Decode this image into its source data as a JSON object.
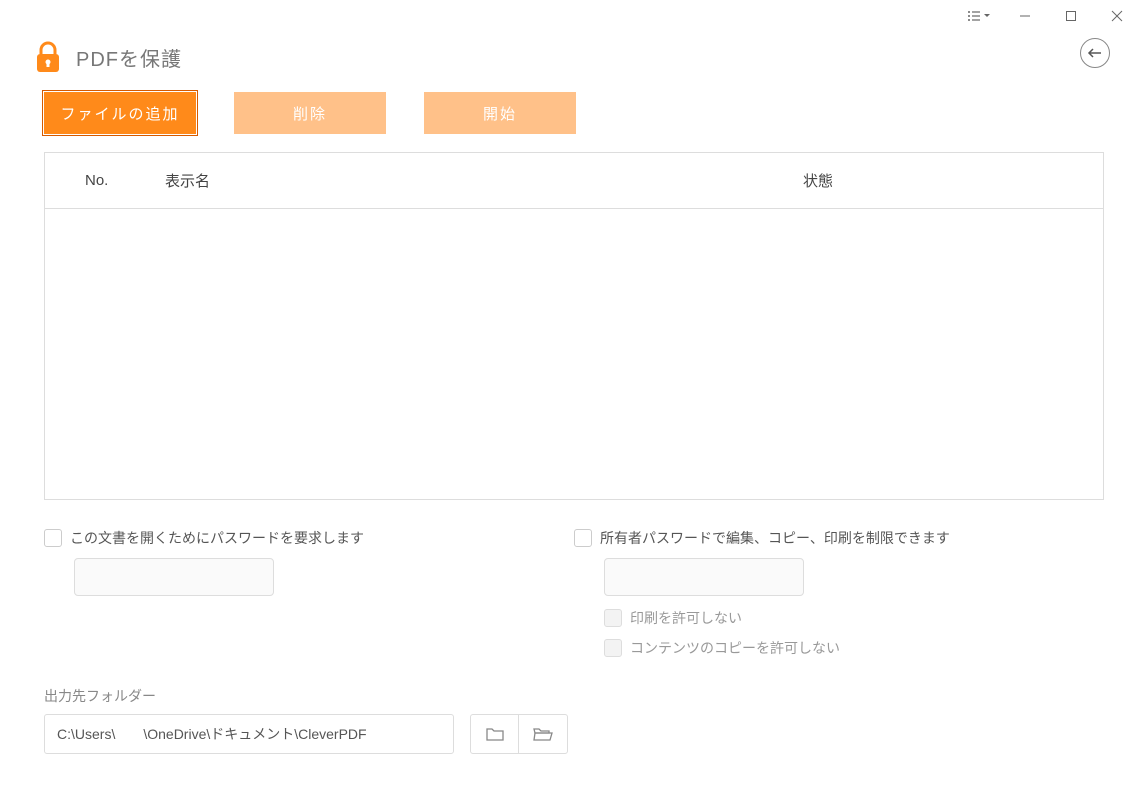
{
  "header": {
    "title": "PDFを保護"
  },
  "toolbar": {
    "add_file": "ファイルの追加",
    "delete": "削除",
    "start": "開始"
  },
  "table": {
    "columns": {
      "no": "No.",
      "name": "表示名",
      "status": "状態"
    }
  },
  "options": {
    "open_password_label": "この文書を開くためにパスワードを要求します",
    "owner_password_label": "所有者パスワードで編集、コピー、印刷を制限できます",
    "no_print_label": "印刷を許可しない",
    "no_copy_label": "コンテンツのコピーを許可しない"
  },
  "output": {
    "label": "出力先フォルダー",
    "path": "C:\\Users\\　　\\OneDrive\\ドキュメント\\CleverPDF"
  }
}
